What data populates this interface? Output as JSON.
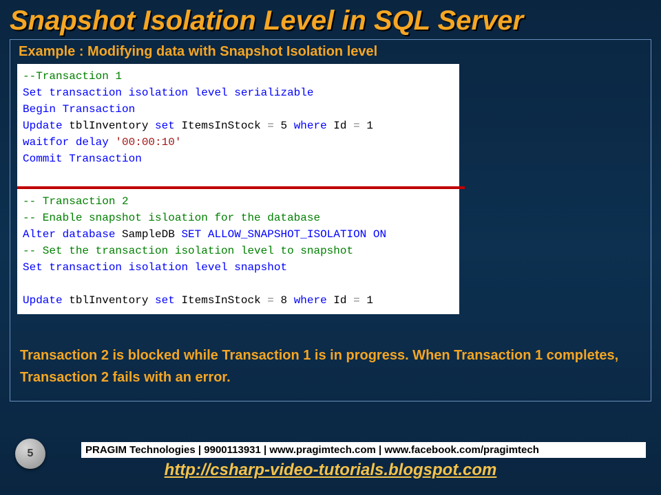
{
  "title": "Snapshot Isolation Level in SQL Server",
  "example_heading": "Example : Modifying data with Snapshot Isolation level",
  "code": {
    "t1_comment": "--Transaction 1",
    "t1_set1": "Set transaction isolation level serializable",
    "t1_begin": "Begin Transaction",
    "t1_update_kw": "Update",
    "t1_update_tbl": " tblInventory ",
    "t1_update_set": "set",
    "t1_update_rest1": " ItemsInStock ",
    "t1_update_eq": "=",
    "t1_update_val1": " 5 ",
    "t1_update_where": "where",
    "t1_update_rest2": " Id ",
    "t1_update_eq2": "=",
    "t1_update_val2": " 1",
    "t1_wait_kw": "waitfor delay ",
    "t1_wait_str": "'00:00:10'",
    "t1_commit": "Commit Transaction",
    "t2_comment": "-- Transaction 2",
    "t2_enable": "-- Enable snapshot isloation for the database",
    "t2_alter_kw": "Alter database",
    "t2_alter_db": " SampleDB ",
    "t2_alter_rest": "SET ALLOW_SNAPSHOT_ISOLATION ON",
    "t2_set_comment": "-- Set the transaction isolation level to snapshot",
    "t2_set": "Set transaction isolation level snapshot",
    "t2_update_kw": "Update",
    "t2_update_tbl": " tblInventory ",
    "t2_update_set": "set",
    "t2_update_rest1": " ItemsInStock ",
    "t2_update_eq": "=",
    "t2_update_val1": " 8 ",
    "t2_update_where": "where",
    "t2_update_rest2": " Id ",
    "t2_update_eq2": "=",
    "t2_update_val2": " 1"
  },
  "explain": "Transaction 2 is blocked while Transaction 1 is in progress. When Transaction 1 completes, Transaction 2 fails with an error.",
  "footer_bar": "PRAGIM Technologies | 9900113931 | www.pragimtech.com | www.facebook.com/pragimtech",
  "footer_link": "http://csharp-video-tutorials.blogspot.com",
  "page_number": "5"
}
